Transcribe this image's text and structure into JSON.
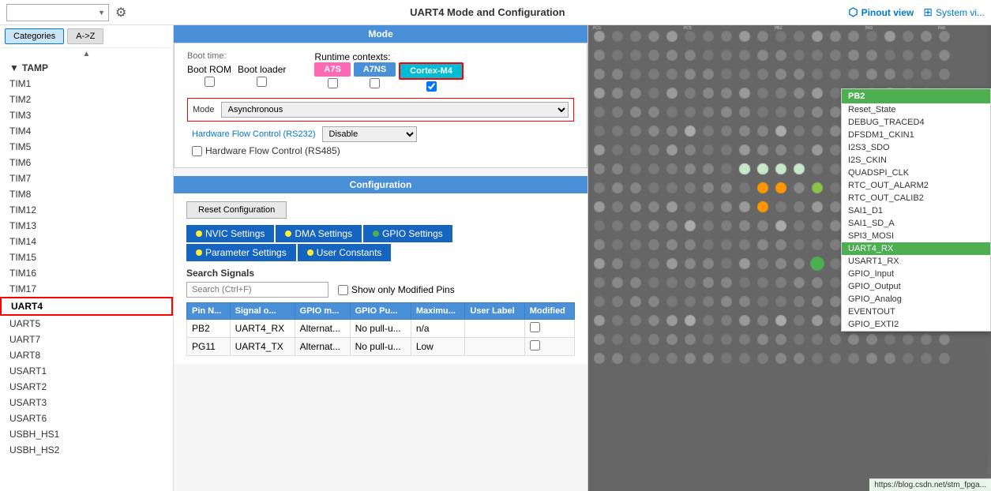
{
  "topbar": {
    "title": "UART4 Mode and Configuration",
    "search_placeholder": "",
    "pinout_view_label": "Pinout view",
    "system_view_label": "System vi..."
  },
  "sidebar_tabs": [
    {
      "label": "Categories",
      "active": true
    },
    {
      "label": "A->Z",
      "active": false
    }
  ],
  "sidebar_items": [
    {
      "label": "TAMP",
      "group": true
    },
    {
      "label": "TIM1"
    },
    {
      "label": "TIM2"
    },
    {
      "label": "TIM3"
    },
    {
      "label": "TIM4"
    },
    {
      "label": "TIM5"
    },
    {
      "label": "TIM6"
    },
    {
      "label": "TIM7"
    },
    {
      "label": "TIM8"
    },
    {
      "label": "TIM12"
    },
    {
      "label": "TIM13"
    },
    {
      "label": "TIM14"
    },
    {
      "label": "TIM15"
    },
    {
      "label": "TIM16"
    },
    {
      "label": "TIM17"
    },
    {
      "label": "UART4",
      "selected": true
    },
    {
      "label": "UART5"
    },
    {
      "label": "UART7"
    },
    {
      "label": "UART8"
    },
    {
      "label": "USART1"
    },
    {
      "label": "USART2"
    },
    {
      "label": "USART3"
    },
    {
      "label": "USART6"
    },
    {
      "label": "USBH_HS1"
    },
    {
      "label": "USBH_HS2"
    }
  ],
  "mode_section": {
    "title": "Mode",
    "boot_time_label": "Boot time:",
    "boot_rom_label": "Boot ROM",
    "boot_loader_label": "Boot loader",
    "runtime_contexts_label": "Runtime contexts:",
    "runtime_chips": [
      {
        "label": "A7S",
        "class": "a7s"
      },
      {
        "label": "A7NS",
        "class": "a7ns"
      },
      {
        "label": "Cortex-M4",
        "class": "cortex"
      }
    ],
    "mode_label": "Mode",
    "mode_value": "Asynchronous",
    "hw_flow_rs232_label": "Hardware Flow Control (RS232)",
    "hw_flow_rs232_value": "Disable",
    "hw_flow_rs485_label": "Hardware Flow Control (RS485)"
  },
  "config_section": {
    "title": "Configuration",
    "reset_btn_label": "Reset Configuration",
    "tabs": [
      {
        "label": "NVIC Settings",
        "dot": "yellow"
      },
      {
        "label": "DMA Settings",
        "dot": "yellow"
      },
      {
        "label": "GPIO Settings",
        "dot": "green"
      },
      {
        "label": "Parameter Settings",
        "dot": "yellow"
      },
      {
        "label": "User Constants",
        "dot": "yellow"
      }
    ]
  },
  "signals": {
    "section_label": "Search Signals",
    "search_placeholder": "Search (Ctrl+F)",
    "show_modified_label": "Show only Modified Pins",
    "columns": [
      "Pin N...",
      "Signal o...",
      "GPIO m...",
      "GPIO Pu...",
      "Maximu...",
      "User Label",
      "Modified"
    ],
    "rows": [
      {
        "pin": "PB2",
        "signal": "UART4_RX",
        "gpio_mode": "Alternat...",
        "gpio_pull": "No pull-u...",
        "max": "n/a",
        "user_label": "",
        "modified": false
      },
      {
        "pin": "PG11",
        "signal": "UART4_TX",
        "gpio_mode": "Alternat...",
        "gpio_pull": "No pull-u...",
        "max": "Low",
        "user_label": "",
        "modified": false
      }
    ]
  },
  "pin_dropdown": {
    "header": "PB2",
    "items": [
      "Reset_State",
      "DEBUG_TRACED4",
      "DFSDM1_CKIN1",
      "I2S3_SDO",
      "I2S_CKIN",
      "QUADSPI_CLK",
      "RTC_OUT_ALARM2",
      "RTC_OUT_CALIB2",
      "SAI1_D1",
      "SAI1_SD_A",
      "SPI3_MOSI",
      "UART4_RX",
      "USART1_RX",
      "GPIO_Input",
      "GPIO_Output",
      "GPIO_Analog",
      "EVENTOUT",
      "GPIO_EXTI2"
    ],
    "highlighted_item": "UART4_RX"
  },
  "url_bar": "https://blog.csdn.net/stm_fpga..."
}
